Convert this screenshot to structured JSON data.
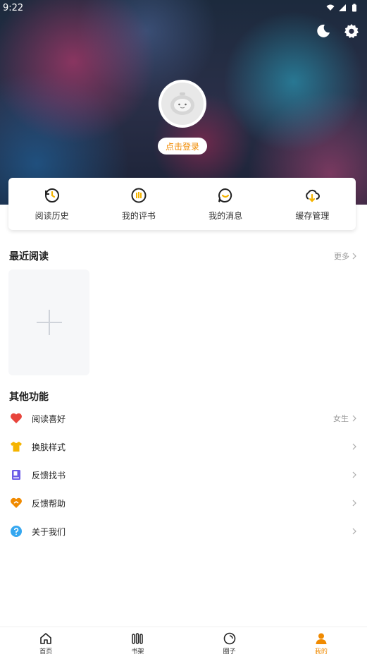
{
  "status_bar": {
    "time": "9:22"
  },
  "header": {
    "login_label": "点击登录"
  },
  "quick_actions": [
    {
      "label": "阅读历史",
      "icon": "history-icon"
    },
    {
      "label": "我的评书",
      "icon": "review-icon"
    },
    {
      "label": "我的消息",
      "icon": "message-icon"
    },
    {
      "label": "缓存管理",
      "icon": "cloud-download-icon"
    }
  ],
  "recent": {
    "title": "最近阅读",
    "more_label": "更多"
  },
  "other": {
    "title": "其他功能",
    "items": [
      {
        "label": "阅读喜好",
        "value": "女生",
        "icon": "heart-icon"
      },
      {
        "label": "换肤样式",
        "value": "",
        "icon": "shirt-icon"
      },
      {
        "label": "反馈找书",
        "value": "",
        "icon": "book-icon"
      },
      {
        "label": "反馈帮助",
        "value": "",
        "icon": "heart-help-icon"
      },
      {
        "label": "关于我们",
        "value": "",
        "icon": "question-icon"
      }
    ]
  },
  "bottom_nav": [
    {
      "label": "首页",
      "icon": "home-icon"
    },
    {
      "label": "书架",
      "icon": "bookshelf-icon"
    },
    {
      "label": "圈子",
      "icon": "circle-icon"
    },
    {
      "label": "我的",
      "icon": "profile-icon"
    }
  ],
  "colors": {
    "accent": "#f08a00"
  }
}
